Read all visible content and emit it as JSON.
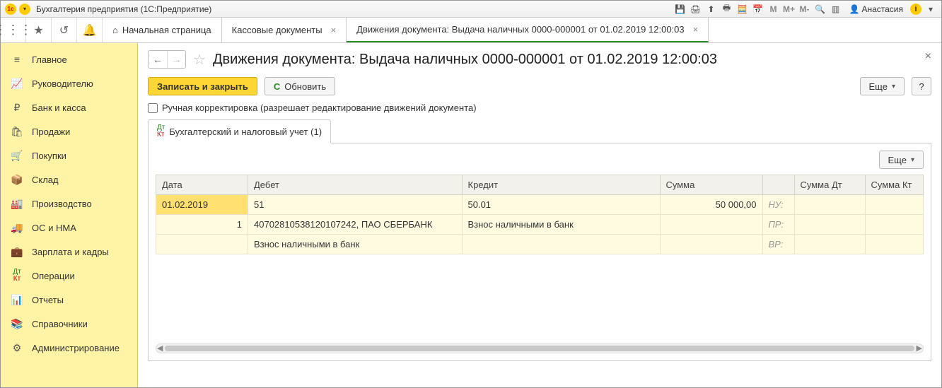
{
  "titlebar": {
    "app_title": "Бухгалтерия предприятия  (1С:Предприятие)",
    "user_name": "Анастасия",
    "m_label": "M",
    "m_plus": "M+",
    "m_minus": "M-"
  },
  "tabs": {
    "home": "Начальная страница",
    "t1": "Кассовые документы",
    "t2": "Движения документа: Выдача наличных 0000-000001 от 01.02.2019 12:00:03"
  },
  "sidebar": {
    "items": [
      "Главное",
      "Руководителю",
      "Банк и касса",
      "Продажи",
      "Покупки",
      "Склад",
      "Производство",
      "ОС и НМА",
      "Зарплата и кадры",
      "Операции",
      "Отчеты",
      "Справочники",
      "Администрирование"
    ]
  },
  "doc": {
    "title": "Движения документа: Выдача наличных 0000-000001 от 01.02.2019 12:00:03",
    "save_close": "Записать и закрыть",
    "refresh": "Обновить",
    "more": "Еще",
    "help": "?",
    "manual_edit_label": "Ручная корректировка (разрешает редактирование движений документа)"
  },
  "innerTab": {
    "label": "Бухгалтерский и налоговый учет (1)"
  },
  "table": {
    "more": "Еще",
    "headers": {
      "date": "Дата",
      "debit": "Дебет",
      "credit": "Кредит",
      "sum": "Сумма",
      "sum_dt": "Сумма Дт",
      "sum_kt": "Сумма Кт"
    },
    "row1": {
      "date": "01.02.2019",
      "debit": "51",
      "credit": "50.01",
      "sum": "50 000,00",
      "tag": "НУ:"
    },
    "row2": {
      "num": "1",
      "debit": "40702810538120107242, ПАО СБЕРБАНК",
      "credit": "Взнос наличными в банк",
      "tag": "ПР:"
    },
    "row3": {
      "debit": "Взнос наличными в банк",
      "tag": "ВР:"
    }
  }
}
